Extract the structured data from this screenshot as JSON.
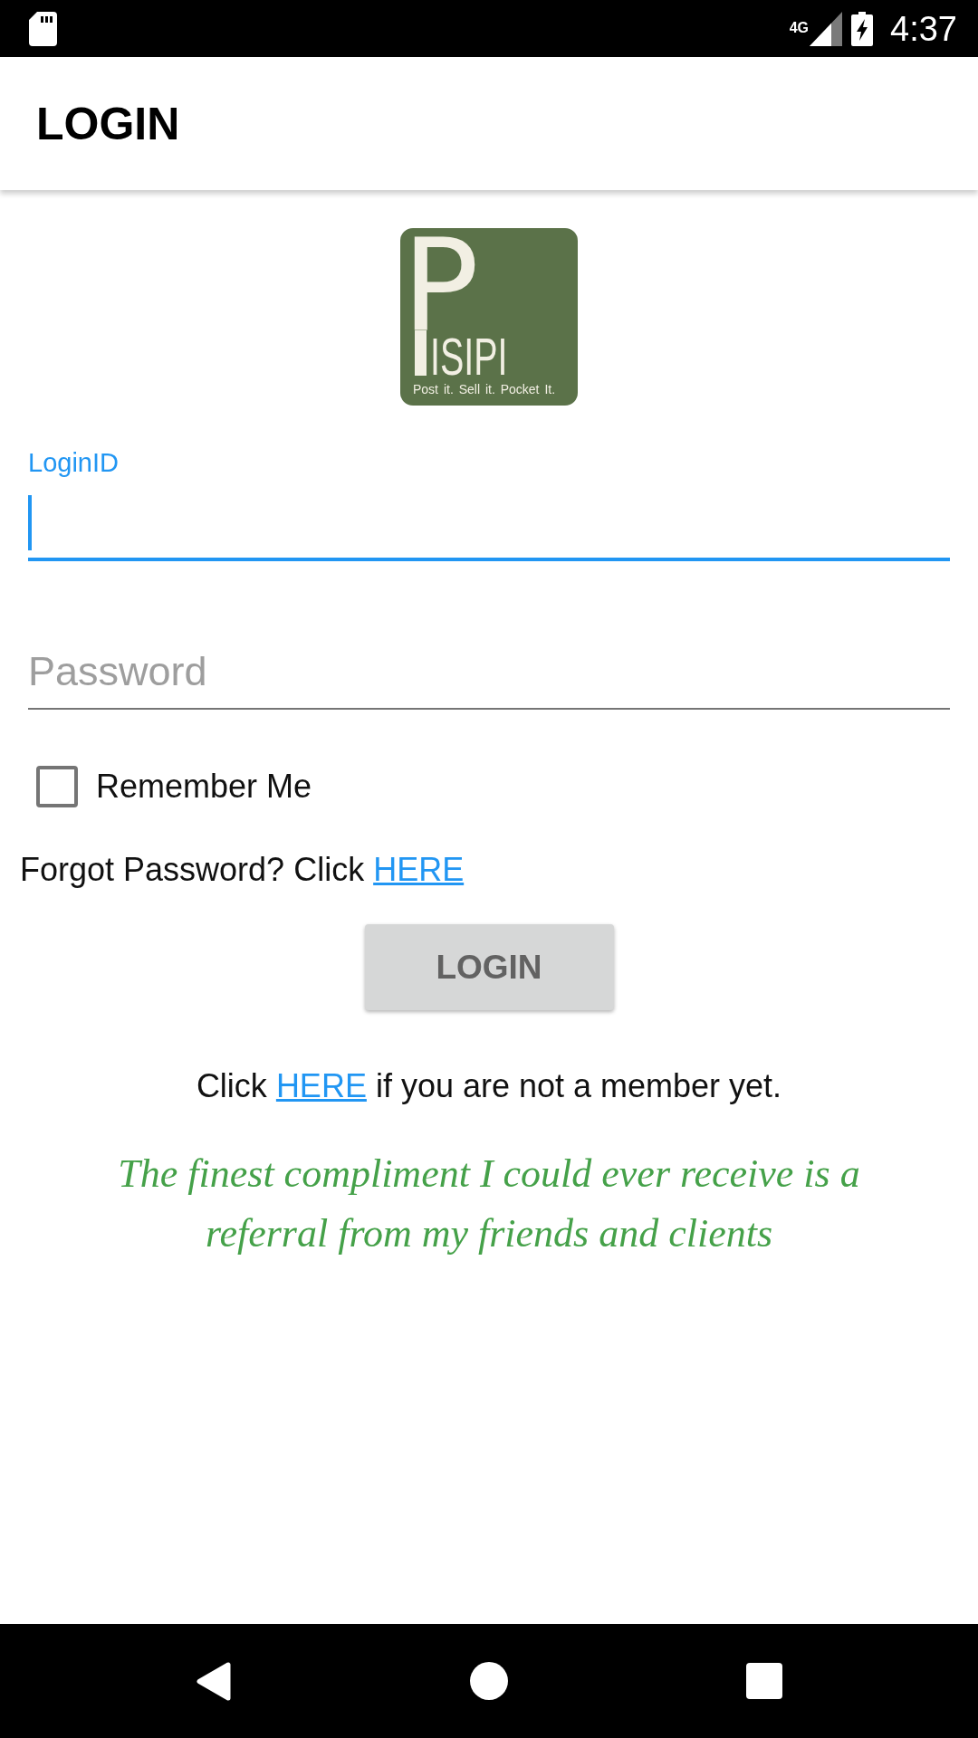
{
  "status_bar": {
    "network": "4G",
    "time": "4:37"
  },
  "app_bar": {
    "title": "LOGIN"
  },
  "logo": {
    "letter": "P",
    "name": "ISIPI",
    "tagline": "Post it. Sell it. Pocket It."
  },
  "login_id": {
    "label": "LoginID",
    "focused": true
  },
  "password": {
    "placeholder": "Password",
    "focused": false
  },
  "remember_me": {
    "label": "Remember Me",
    "checked": false
  },
  "forgot_password": {
    "text": "Forgot Password? Click",
    "link": "HERE"
  },
  "login_button": {
    "label": "LOGIN"
  },
  "signup": {
    "before": "Click",
    "link": "HERE",
    "after": "if you are not a member yet."
  },
  "quote": "The finest compliment I could ever receive is a referral from my friends and clients"
}
